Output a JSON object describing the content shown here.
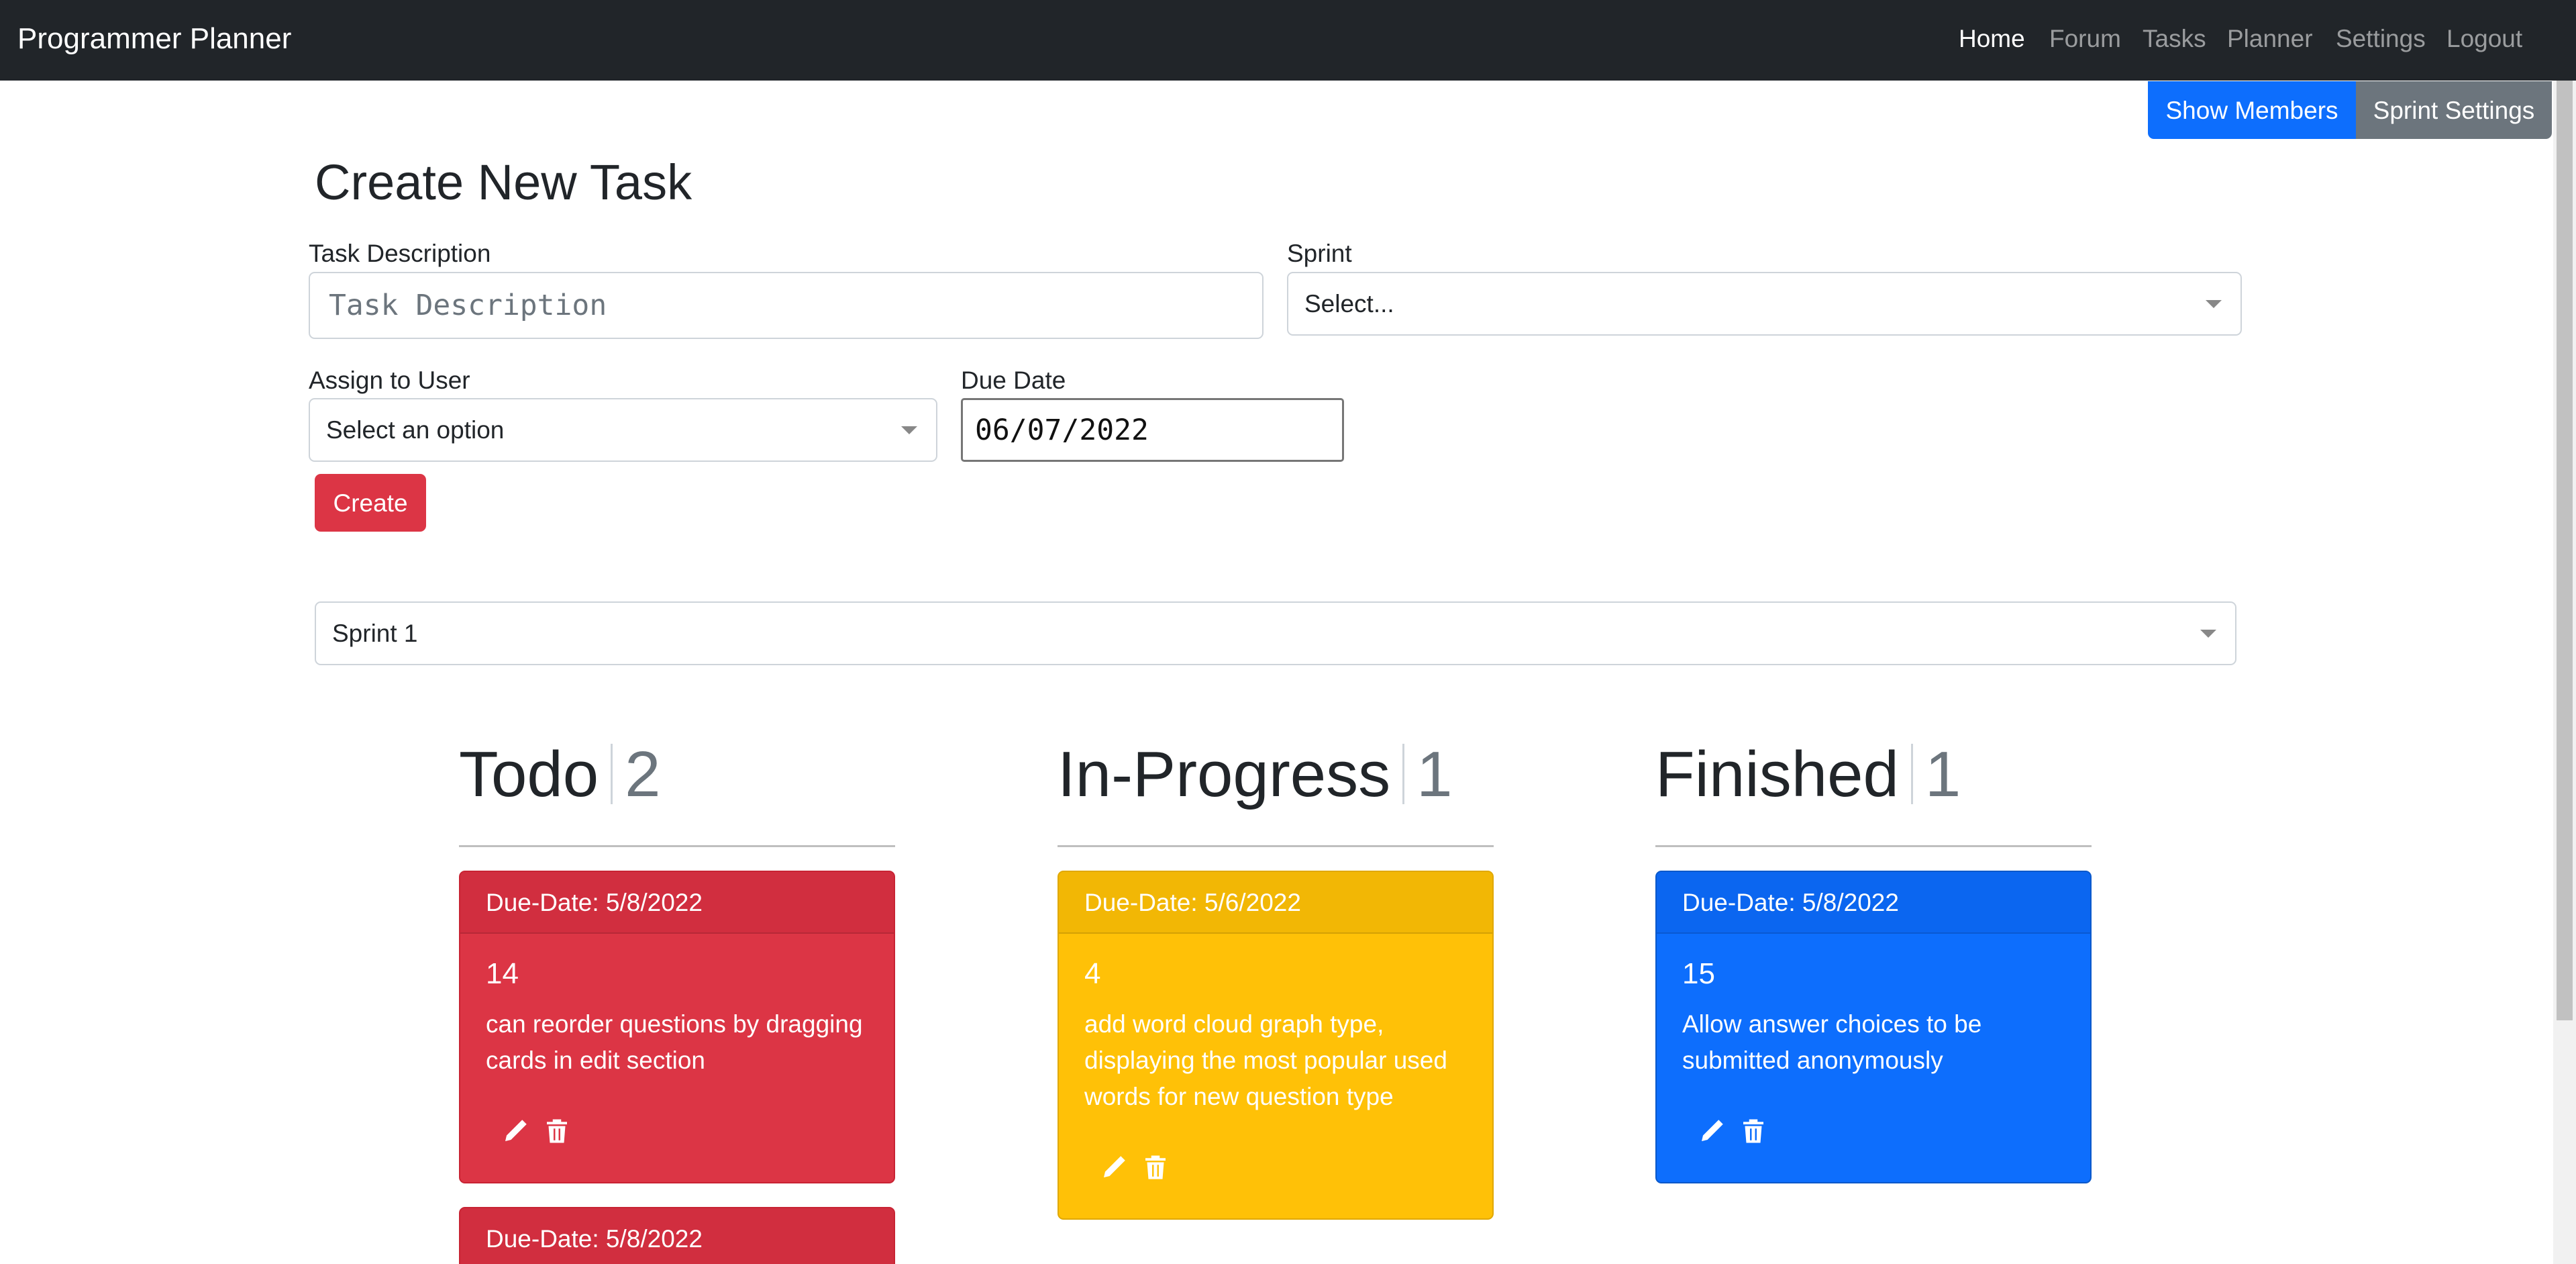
{
  "navbar": {
    "brand": "Programmer Planner",
    "links": [
      {
        "label": "Home",
        "active": true
      },
      {
        "label": "Forum",
        "active": false
      },
      {
        "label": "Tasks",
        "active": false
      },
      {
        "label": "Planner",
        "active": false
      },
      {
        "label": "Settings",
        "active": false
      },
      {
        "label": "Logout",
        "active": false
      }
    ]
  },
  "top_buttons": {
    "show_members": "Show Members",
    "sprint_settings": "Sprint Settings"
  },
  "form": {
    "title": "Create New Task",
    "task_description_label": "Task Description",
    "task_description_placeholder": "Task Description",
    "sprint_label": "Sprint",
    "sprint_value": "Select...",
    "assign_label": "Assign to User",
    "assign_value": "Select an option",
    "due_date_label": "Due Date",
    "due_date_value": "06/07/2022",
    "create_label": "Create"
  },
  "sprint_filter": {
    "value": "Sprint 1"
  },
  "columns": [
    {
      "title": "Todo",
      "count": "2"
    },
    {
      "title": "In-Progress",
      "count": "1"
    },
    {
      "title": "Finished",
      "count": "1"
    }
  ],
  "cards": {
    "todo_1": {
      "due": "Due-Date: 5/8/2022",
      "number": "14",
      "text": "can reorder questions by dragging cards in edit section"
    },
    "todo_2": {
      "due": "Due-Date: 5/8/2022"
    },
    "progress_1": {
      "due": "Due-Date: 5/6/2022",
      "number": "4",
      "text": "add word cloud graph type, displaying the most popular used words for new question type"
    },
    "finished_1": {
      "due": "Due-Date: 5/8/2022",
      "number": "15",
      "text": "Allow answer choices to be submitted anonymously"
    }
  },
  "colors": {
    "navbar": "#212529",
    "primary": "#0d6efd",
    "secondary": "#6c757d",
    "danger": "#dc3545",
    "warning": "#ffc107"
  }
}
